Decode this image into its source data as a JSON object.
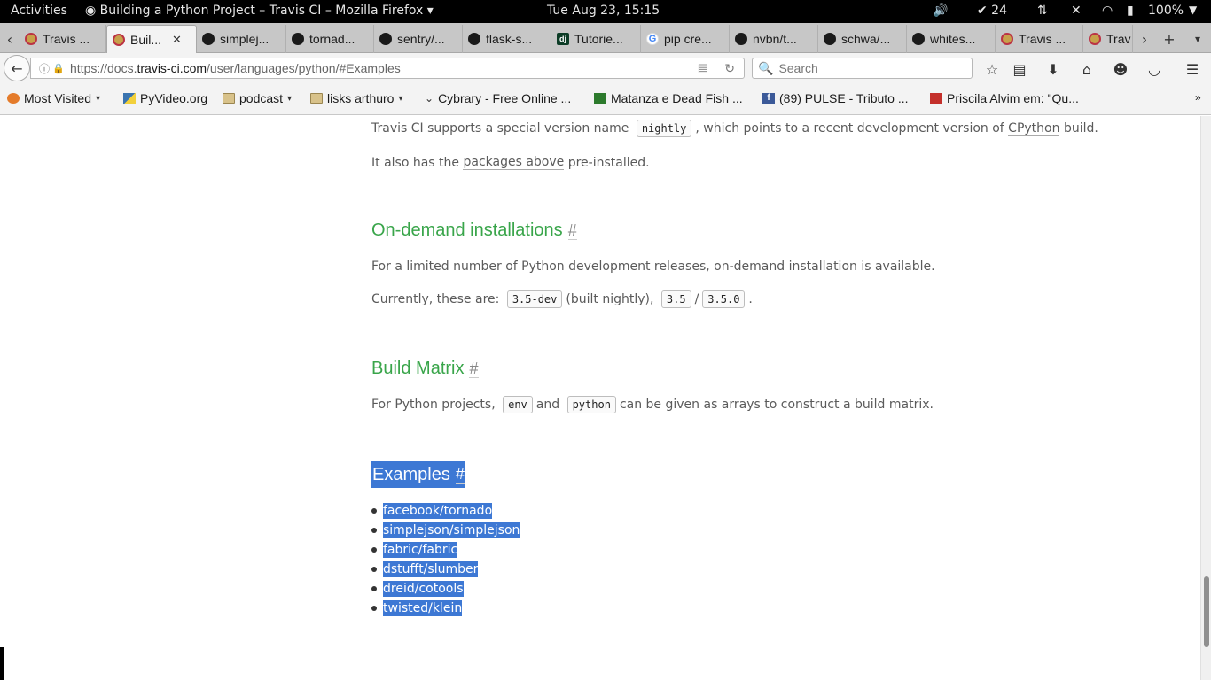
{
  "topbar": {
    "activities": "Activities",
    "app_title": "Building a Python Project – Travis CI – Mozilla Firefox",
    "clock": "Tue Aug 23, 15:15",
    "updates": "✔ 24",
    "battery": "100%"
  },
  "tabs": [
    {
      "label": "Travis ...",
      "icon": "travis"
    },
    {
      "label": "Buil...",
      "icon": "travis"
    },
    {
      "label": "simplej...",
      "icon": "github"
    },
    {
      "label": "tornad...",
      "icon": "github"
    },
    {
      "label": "sentry/...",
      "icon": "github"
    },
    {
      "label": "flask-s...",
      "icon": "github"
    },
    {
      "label": "Tutorie...",
      "icon": "django"
    },
    {
      "label": "pip cre...",
      "icon": "google"
    },
    {
      "label": "nvbn/t...",
      "icon": "github"
    },
    {
      "label": "schwa/...",
      "icon": "github"
    },
    {
      "label": "whites...",
      "icon": "github"
    },
    {
      "label": "Travis ...",
      "icon": "travis"
    },
    {
      "label": "Trav",
      "icon": "travis"
    }
  ],
  "nav": {
    "url_prefix": "https://docs.",
    "url_domain": "travis-ci.com",
    "url_path": "/user/languages/python/#Examples",
    "search_placeholder": "Search"
  },
  "bookmarks": [
    {
      "label": "Most Visited",
      "icon": "gear"
    },
    {
      "label": "PyVideo.org",
      "icon": "pyvideo"
    },
    {
      "label": "podcast",
      "icon": "folder"
    },
    {
      "label": "lisks arthuro",
      "icon": "folder"
    },
    {
      "label": "Cybrary - Free Online ...",
      "icon": "cybrary"
    },
    {
      "label": "Matanza e Dead Fish ...",
      "icon": "matanza"
    },
    {
      "label": "(89) PULSE - Tributo ...",
      "icon": "facebook"
    },
    {
      "label": "Priscila Alvim em: \"Qu...",
      "icon": "youtube"
    }
  ],
  "content": {
    "nightly_pre": "Travis CI supports a special version name",
    "nightly_code": "nightly",
    "nightly_mid": ", which points to a recent development version of",
    "nightly_link": "CPython",
    "nightly_post": "build.",
    "packages_pre": "It also has the",
    "packages_link": "packages above",
    "packages_post": "pre-installed.",
    "ondemand_title": "On-demand installations",
    "hash": "#",
    "ondemand_desc": "For a limited number of Python development releases, on-demand installation is available.",
    "currently_pre": "Currently, these are:",
    "code_35dev": "3.5-dev",
    "built_nightly": "(built nightly),",
    "code_35": "3.5",
    "slash": "/",
    "code_350": "3.5.0",
    "period": ".",
    "matrix_title": "Build Matrix",
    "matrix_pre": "For Python projects,",
    "matrix_env": "env",
    "matrix_and": "and",
    "matrix_python": "python",
    "matrix_post": "can be given as arrays to construct a build matrix.",
    "examples_title": "Examples",
    "examples": [
      "facebook/tornado",
      "simplejson/simplejson",
      "fabric/fabric",
      "dstufft/slumber",
      "dreid/cotools",
      "twisted/klein"
    ]
  }
}
